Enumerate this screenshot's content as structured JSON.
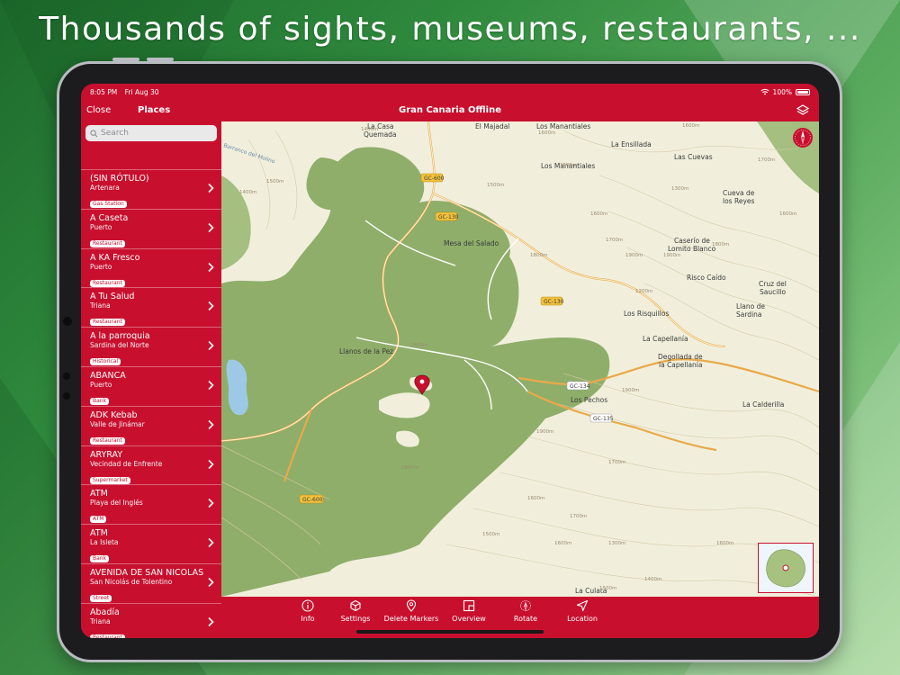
{
  "headline": "Thousands of sights, museums, restaurants, ...",
  "status": {
    "time": "8:05 PM",
    "date": "Fri Aug 30",
    "battery": "100%"
  },
  "nav": {
    "close": "Close",
    "places": "Places",
    "title": "Gran Canaria Offline"
  },
  "search": {
    "placeholder": "Search"
  },
  "places": [
    {
      "name": "(SIN RÓTULO)",
      "area": "Artenara",
      "tag": "Gas Station"
    },
    {
      "name": "A Caseta",
      "area": "Puerto",
      "tag": "Restaurant"
    },
    {
      "name": "A KA Fresco",
      "area": "Puerto",
      "tag": "Restaurant"
    },
    {
      "name": "A Tu Salud",
      "area": "Triana",
      "tag": "Restaurant"
    },
    {
      "name": "A la parroquia",
      "area": "Sardina del Norte",
      "tag": "Historical"
    },
    {
      "name": "ABANCA",
      "area": "Puerto",
      "tag": "Bank"
    },
    {
      "name": "ADK Kebab",
      "area": "Valle de Jinámar",
      "tag": "Restaurant"
    },
    {
      "name": "ARYRAY",
      "area": "Vecindad de Enfrente",
      "tag": "Supermarket"
    },
    {
      "name": "ATM",
      "area": "Playa del Inglés",
      "tag": "ATM"
    },
    {
      "name": "ATM",
      "area": "La Isleta",
      "tag": "Bank"
    },
    {
      "name": "AVENIDA DE SAN NICOLAS",
      "area": "San Nicolás de Tolentino",
      "tag": "Street"
    },
    {
      "name": "Abadía",
      "area": "Triana",
      "tag": "Restaurant"
    }
  ],
  "map": {
    "places": {
      "la_casa_quemada_1": "La Casa",
      "la_casa_quemada_2": "Quemada",
      "el_majadal": "El Majadal",
      "los_manantiales_top": "Los Manantiales",
      "la_ensillada": "La Ensillada",
      "las_cuevas": "Las Cuevas",
      "los_manantiales": "Los Manantiales",
      "cueva_1": "Cueva de",
      "cueva_2": "los Reyes",
      "mesa": "Mesa del Salado",
      "caserio_1": "Caserío de",
      "caserio_2": "Lomito Blanco",
      "risco": "Risco Caído",
      "cruz_1": "Cruz del",
      "cruz_2": "Saucillo",
      "llano_1": "Llano de",
      "llano_2": "Sardina",
      "risquillos": "Los Risquillos",
      "capellania": "La Capellanía",
      "degollada_1": "Degollada de",
      "degollada_2": "la Capellanía",
      "llanos_pez": "Llanos de la Pez",
      "los_pechos": "Los Pechos",
      "calderilla": "La Calderilla",
      "culata": "La Culata",
      "barranco": "Barranco del Molino"
    },
    "roads": {
      "gc600_a": "GC-600",
      "gc130_a": "GC-130",
      "gc130_b": "GC-130",
      "gc134": "GC-134",
      "gc135": "GC-135",
      "gc600_b": "GC-600"
    },
    "elev": [
      "1600m",
      "1500m",
      "1400m",
      "1500m",
      "1600m",
      "1600m",
      "1700m",
      "1800m",
      "1900m",
      "1900m",
      "1800m",
      "1700m",
      "1600m",
      "1500m",
      "1400m",
      "1300m",
      "1200m",
      "1800m",
      "1900m",
      "1700m",
      "1600m",
      "1700m",
      "1600m",
      "1500m",
      "1600m",
      "1900m",
      "1300m",
      "1400m",
      "1500m",
      "1800m"
    ]
  },
  "tabs": [
    {
      "label": "Info",
      "icon": "info-icon"
    },
    {
      "label": "Settings",
      "icon": "settings-icon"
    },
    {
      "label": "Delete Markers",
      "icon": "marker-icon"
    },
    {
      "label": "Overview",
      "icon": "overview-icon"
    },
    {
      "label": "Rotate",
      "icon": "rotate-icon"
    },
    {
      "label": "Location",
      "icon": "location-arrow-icon"
    }
  ],
  "colors": {
    "brand": "#c8102e",
    "forest": "#8fae6a",
    "land": "#f1efdc",
    "road": "#e9a94a",
    "water": "#9ec9e6"
  }
}
